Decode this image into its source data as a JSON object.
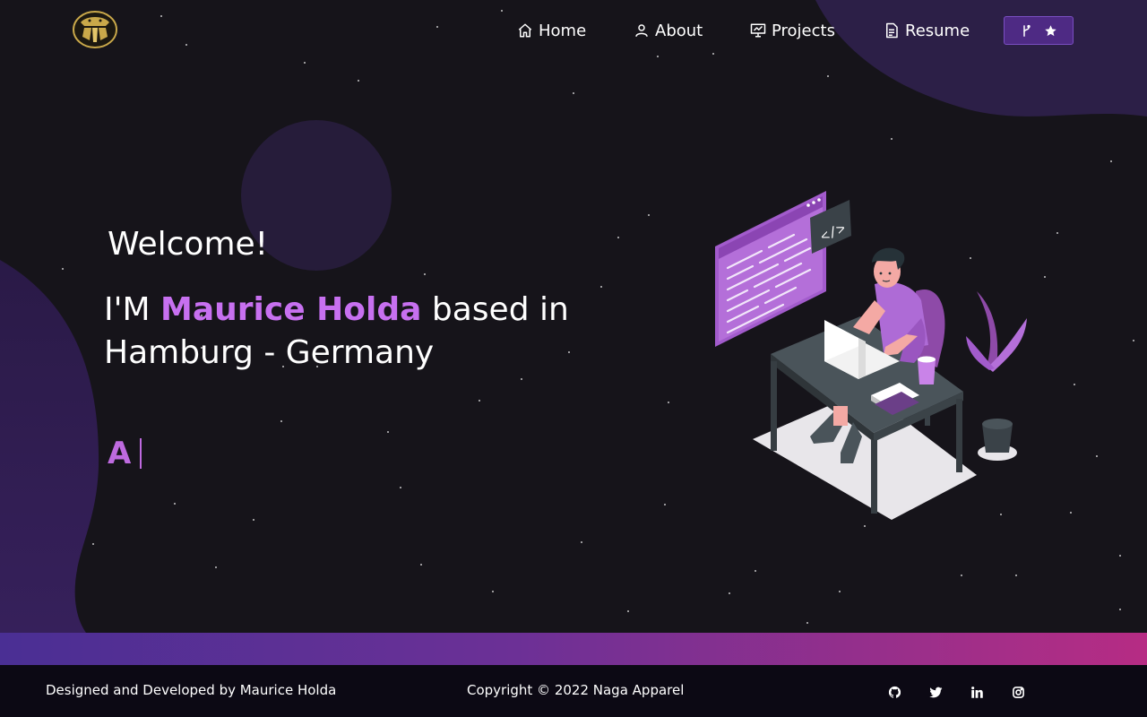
{
  "nav": {
    "logo_icon": "naga-crest-logo",
    "items": [
      {
        "label": "Home",
        "icon": "home-icon"
      },
      {
        "label": "About",
        "icon": "user-icon"
      },
      {
        "label": "Projects",
        "icon": "presentation-icon"
      },
      {
        "label": "Resume",
        "icon": "document-icon"
      }
    ],
    "repo_button": {
      "icons": [
        "git-fork-icon",
        "star-icon"
      ]
    }
  },
  "hero": {
    "greeting": "Welcome!",
    "intro_prefix": "I'M",
    "name": "Maurice Holda",
    "intro_suffix": "based in Hamburg - Germany",
    "typewriter_text": "A",
    "illustration": "developer-at-desk-illustration"
  },
  "footer": {
    "designed_by": "Designed and Developed by Maurice Holda",
    "copyright": "Copyright © 2022 Naga Apparel",
    "social": [
      "github-icon",
      "twitter-icon",
      "linkedin-icon",
      "instagram-icon"
    ]
  },
  "colors": {
    "background": "#16141a",
    "accent": "#c770f0",
    "footer_bg": "#0c0914",
    "button_bg": "#4e2a84"
  }
}
